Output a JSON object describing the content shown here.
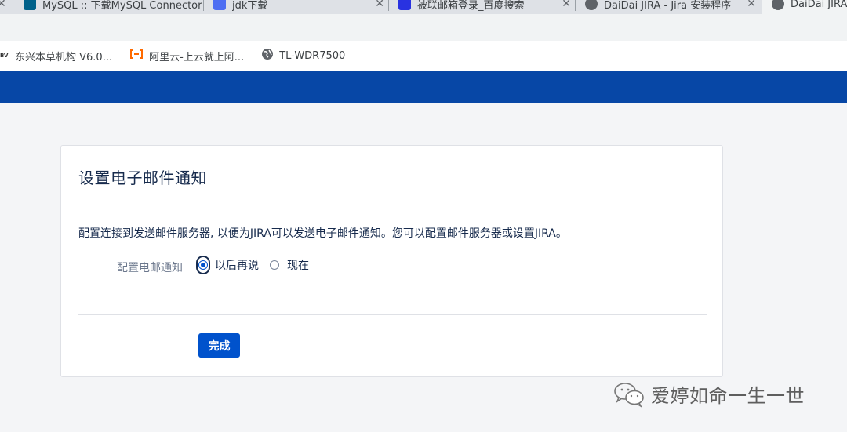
{
  "browser": {
    "tabs": [
      {
        "title": "MySQL :: 下载MySQL Connector",
        "favicon": "mysql-icon",
        "color": "#00618a",
        "active": false
      },
      {
        "title": "jdk下载",
        "favicon": "search-paw-icon",
        "color": "#4e6ef2",
        "active": false
      },
      {
        "title": "被联邮箱登录_百度搜索",
        "favicon": "baidu-icon",
        "color": "#2932e1",
        "active": false
      },
      {
        "title": "DaiDai JIRA - Jira 安装程序",
        "favicon": "globe-icon",
        "color": "#5f6368",
        "active": false
      },
      {
        "title": "DaiDai JIRA",
        "favicon": "globe-icon",
        "color": "#5f6368",
        "active": true
      }
    ],
    "bookmarks": [
      {
        "label": "东兴本草机构 V6.0...",
        "icon": "dxbs-icon",
        "icon_text": "BVS"
      },
      {
        "label": "阿里云-上云就上阿...",
        "icon": "aliyun-icon",
        "color": "#ff6a00"
      },
      {
        "label": "TL-WDR7500",
        "icon": "globe-icon"
      }
    ]
  },
  "theme": {
    "header": "#0747a6",
    "primary": "#0052cc"
  },
  "setup": {
    "title": "设置电子邮件通知",
    "description": "配置连接到发送邮件服务器, 以便为JIRA可以发送电子邮件通知。您可以配置邮件服务器或设置JIRA。",
    "field_label": "配置电邮通知",
    "options": [
      {
        "label": "以后再说",
        "checked": true
      },
      {
        "label": "现在",
        "checked": false
      }
    ],
    "submit_label": "完成"
  },
  "watermark": {
    "text": "爱婷如命一生一世",
    "icon": "wechat-icon"
  }
}
